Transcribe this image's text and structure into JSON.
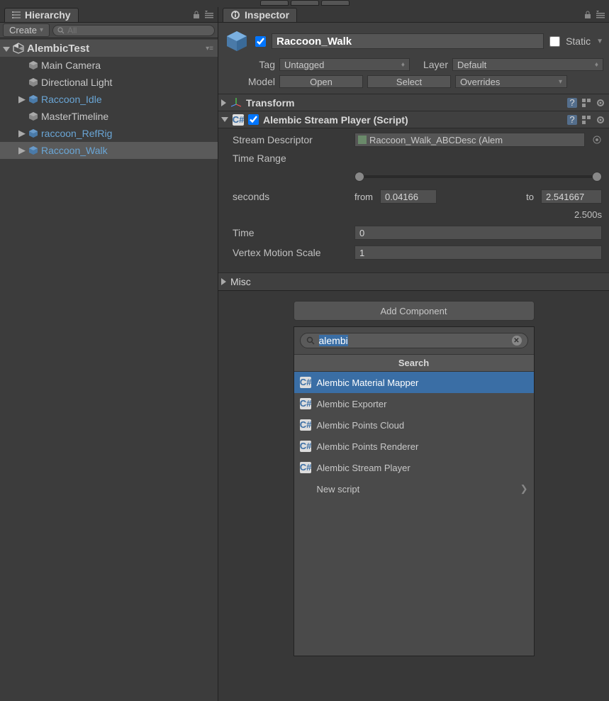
{
  "hierarchy": {
    "tab_label": "Hierarchy",
    "create_label": "Create",
    "search_placeholder": "All",
    "scene": "AlembicTest",
    "items": [
      {
        "label": "Main Camera",
        "link": false,
        "arrow": ""
      },
      {
        "label": "Directional Light",
        "link": false,
        "arrow": ""
      },
      {
        "label": "Raccoon_Idle",
        "link": true,
        "arrow": "▶"
      },
      {
        "label": "MasterTimeline",
        "link": false,
        "arrow": ""
      },
      {
        "label": "raccoon_RefRig",
        "link": true,
        "arrow": "▶"
      },
      {
        "label": "Raccoon_Walk",
        "link": true,
        "arrow": "▶",
        "selected": true
      }
    ]
  },
  "inspector": {
    "tab_label": "Inspector",
    "object_name": "Raccoon_Walk",
    "static_label": "Static",
    "tag_label": "Tag",
    "tag_value": "Untagged",
    "layer_label": "Layer",
    "layer_value": "Default",
    "model_label": "Model",
    "open_btn": "Open",
    "select_btn": "Select",
    "overrides_btn": "Overrides",
    "transform_title": "Transform",
    "asp": {
      "title": "Alembic Stream Player (Script)",
      "stream_descriptor_label": "Stream Descriptor",
      "stream_descriptor_value": "Raccoon_Walk_ABCDesc (Alem",
      "time_range_label": "Time Range",
      "seconds_label": "seconds",
      "from_label": "from",
      "from_value": "0.04166",
      "to_label": "to",
      "to_value": "2.541667",
      "duration": "2.500s",
      "time_label": "Time",
      "time_value": "0",
      "vms_label": "Vertex Motion Scale",
      "vms_value": "1"
    },
    "misc_title": "Misc",
    "add_component_label": "Add Component",
    "popup": {
      "search_value": "alembi",
      "search_header": "Search",
      "items": [
        {
          "label": "Alembic Material Mapper",
          "selected": true
        },
        {
          "label": "Alembic Exporter"
        },
        {
          "label": "Alembic Points Cloud"
        },
        {
          "label": "Alembic Points Renderer"
        },
        {
          "label": "Alembic Stream Player"
        }
      ],
      "new_script": "New script"
    }
  }
}
